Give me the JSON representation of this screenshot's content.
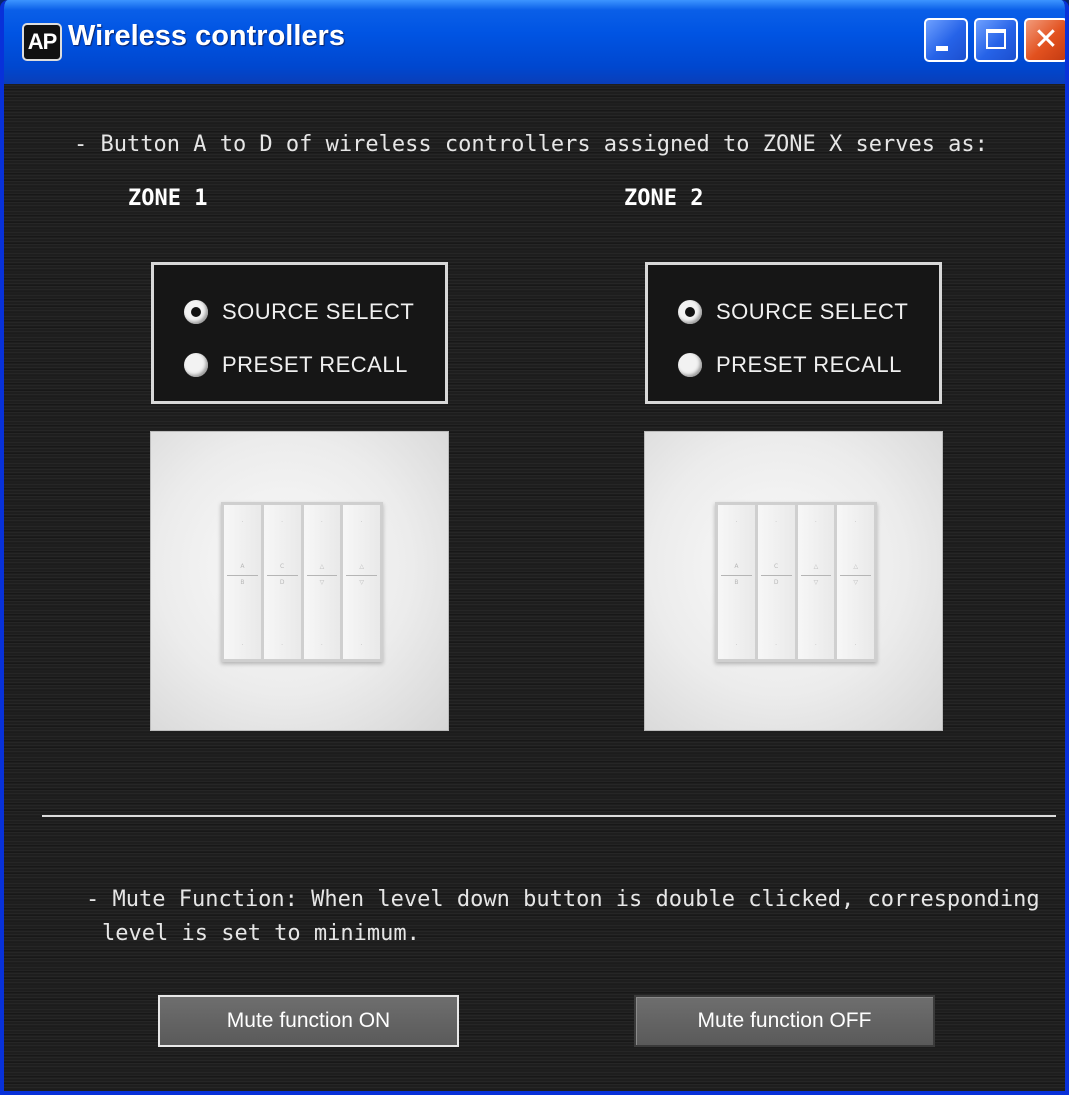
{
  "window": {
    "title": "Wireless controllers",
    "app_icon": "AP",
    "controls": {
      "minimize": "minimize-icon",
      "maximize": "maximize-icon",
      "close": "close-icon"
    }
  },
  "main": {
    "description": "- Button A to D of wireless controllers assigned to ZONE X serves as:",
    "zones": [
      {
        "title": "ZONE 1",
        "options": [
          {
            "label": "SOURCE SELECT",
            "selected": true
          },
          {
            "label": "PRESET RECALL",
            "selected": false
          }
        ]
      },
      {
        "title": "ZONE 2",
        "options": [
          {
            "label": "SOURCE SELECT",
            "selected": true
          },
          {
            "label": "PRESET RECALL",
            "selected": false
          }
        ]
      }
    ],
    "mute_description_line1": "- Mute Function: When level down button is double clicked, corresponding",
    "mute_description_line2": "level is set to minimum.",
    "buttons": {
      "mute_on": "Mute function ON",
      "mute_off": "Mute function OFF"
    }
  },
  "colors": {
    "titlebar": "#0054e3",
    "close_button": "#e2511f",
    "background": "#1e1e1e",
    "text": "#e6e6e6"
  }
}
